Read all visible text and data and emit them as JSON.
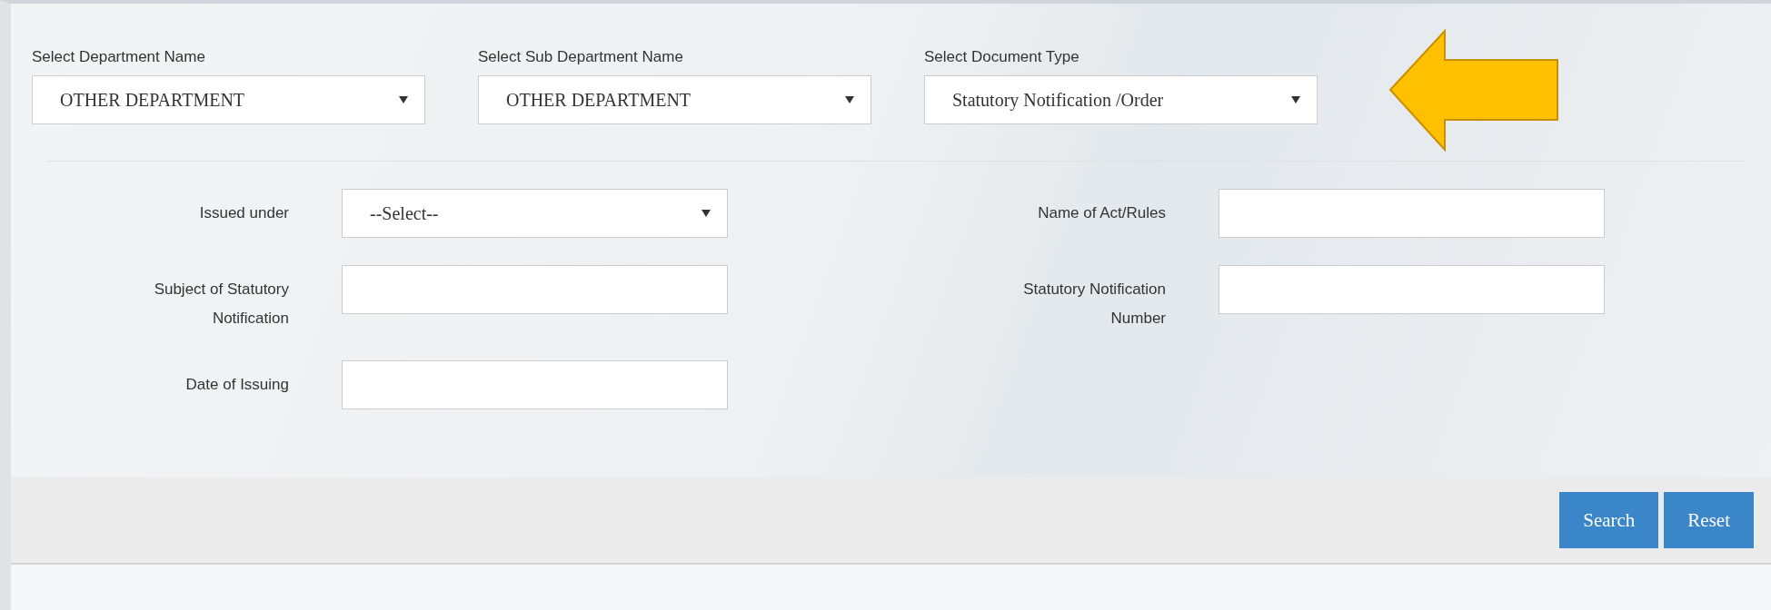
{
  "filters": [
    {
      "label": "Select Department Name",
      "value": "OTHER DEPARTMENT"
    },
    {
      "label": "Select Sub Department Name",
      "value": "OTHER DEPARTMENT"
    },
    {
      "label": "Select Document Type",
      "value": "Statutory Notification /Order"
    }
  ],
  "fields": [
    {
      "kind": "select",
      "label": "Issued under",
      "value": "--Select--"
    },
    {
      "kind": "text",
      "label": "Name of Act/Rules"
    },
    {
      "kind": "text",
      "label": "Subject of Statutory Notification"
    },
    {
      "kind": "text",
      "label": "Statutory Notification Number"
    },
    {
      "kind": "text",
      "label": "Date of Issuing"
    }
  ],
  "buttons": [
    "Search",
    "Reset"
  ]
}
